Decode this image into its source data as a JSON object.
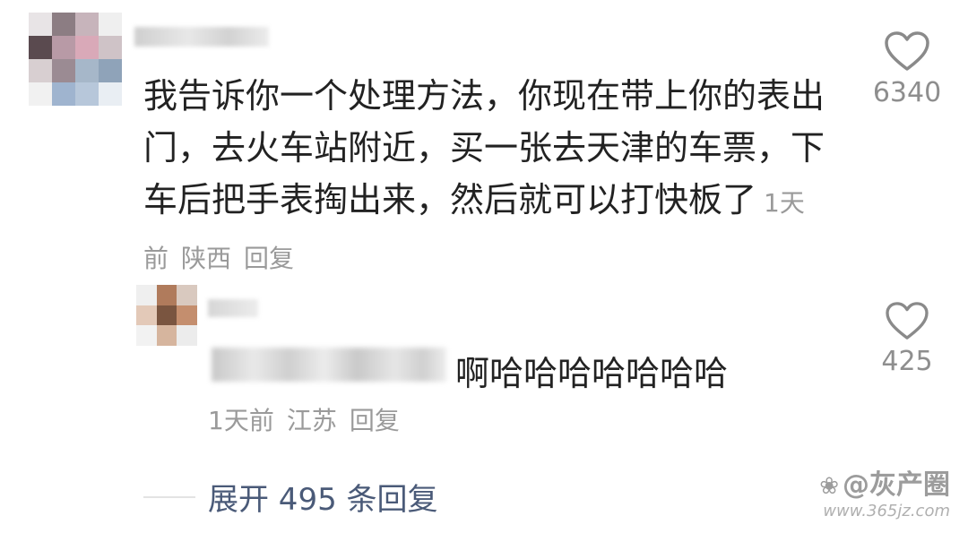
{
  "comment": {
    "text": "我告诉你一个处理方法，你现在带上你的表出门，去火车站附近，买一张去天津的车票，下车后把手表掏出来，然后就可以打快板了",
    "time": "1天前",
    "location": "陕西",
    "reply_label": "回复",
    "like_count": "6340"
  },
  "reply": {
    "text": "啊哈哈哈哈哈哈哈",
    "time": "1天前",
    "location": "江苏",
    "reply_label": "回复",
    "like_count": "425"
  },
  "expand_label": "展开 495 条回复",
  "watermark": {
    "brand": "@灰产圈",
    "url": "www.365jz.com"
  },
  "icons": {
    "like": "heart-outline-icon",
    "watermark": "paw-icon"
  },
  "colors": {
    "text": "#222222",
    "meta": "#9a9a9a",
    "expand": "#4a5a78",
    "like_icon": "#8a8a8a"
  }
}
